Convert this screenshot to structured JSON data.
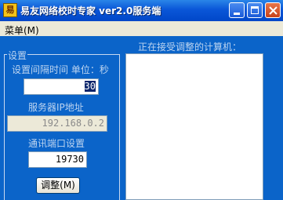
{
  "window": {
    "title": "易友网络校时专家 ver2.0服务端",
    "icon_glyph": "易"
  },
  "menu": {
    "items": [
      {
        "label": "菜单(M)"
      }
    ]
  },
  "settings": {
    "group_title": "设置",
    "interval_label": "设置间隔时间 单位：秒",
    "interval_value": "30",
    "server_ip_label": "服务器IP地址",
    "server_ip_value": "192.168.0.2",
    "port_label": "通讯端口设置",
    "port_value": "19730",
    "adjust_button": "调整(M)"
  },
  "clients": {
    "label": "正在接受调整的计算机：",
    "items": []
  },
  "colors": {
    "window_bg": "#0b64c9",
    "titlebar": "#0a56d8",
    "label_text": "#bcd4f0"
  }
}
